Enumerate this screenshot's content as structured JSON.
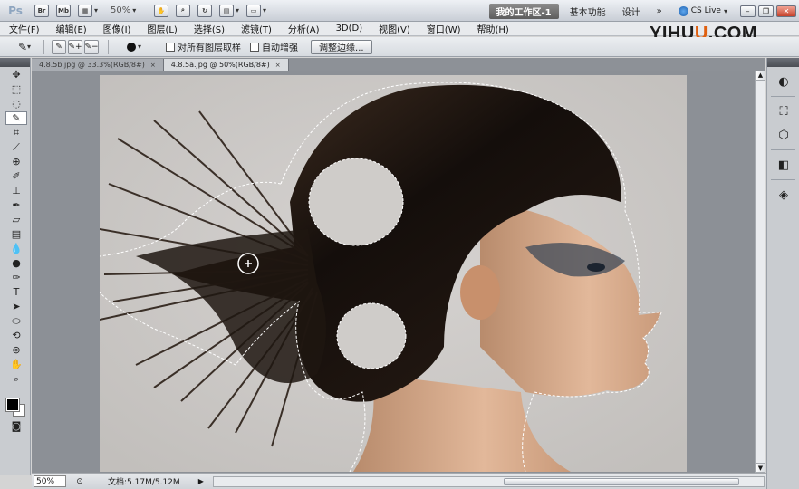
{
  "appbar": {
    "logo": "Ps",
    "btn_br": "Br",
    "btn_mb": "Mb",
    "zoom": "50%",
    "workspace_active": "我的工作区-1",
    "workspace_basic": "基本功能",
    "workspace_design": "设计",
    "more": "»",
    "cs_live": "CS Live"
  },
  "menu": [
    "文件(F)",
    "编辑(E)",
    "图像(I)",
    "图层(L)",
    "选择(S)",
    "滤镜(T)",
    "分析(A)",
    "3D(D)",
    "视图(V)",
    "窗口(W)",
    "帮助(H)"
  ],
  "watermark": {
    "part1": "YIHU",
    "part2": "U",
    "part3": ".COM"
  },
  "options": {
    "sample_all_layers": "对所有图层取样",
    "auto_enhance": "自动增强",
    "refine_edge": "调整边缘..."
  },
  "tabs": [
    {
      "label": "4.8.5b.jpg @ 33.3%(RGB/8#)",
      "close": "×"
    },
    {
      "label": "4.8.5a.jpg @ 50%(RGB/8#)",
      "close": "×"
    }
  ],
  "status": {
    "zoom": "50%",
    "doc_info": "文档:5.17M/5.12M",
    "arrow": "▶"
  },
  "colors": {
    "foreground": "#000000",
    "background": "#ffffff",
    "canvas_bg": "#cfcdcb",
    "hair": "#1a1411"
  },
  "icons": {
    "tools": [
      "move-icon",
      "marquee-icon",
      "lasso-icon",
      "quick-selection-icon",
      "crop-icon",
      "eyedropper-icon",
      "spot-healing-icon",
      "brush-icon",
      "clone-stamp-icon",
      "history-brush-icon",
      "eraser-icon",
      "gradient-icon",
      "blur-icon",
      "dodge-icon",
      "pen-icon",
      "type-icon",
      "path-selection-icon",
      "shape-icon",
      "3d-rotate-icon",
      "3d-orbit-icon",
      "hand-icon",
      "zoom-icon"
    ],
    "panel": [
      "navigator-icon",
      "transform-icon",
      "3d-icon",
      "adjustments-icon",
      "layers-icon"
    ]
  }
}
